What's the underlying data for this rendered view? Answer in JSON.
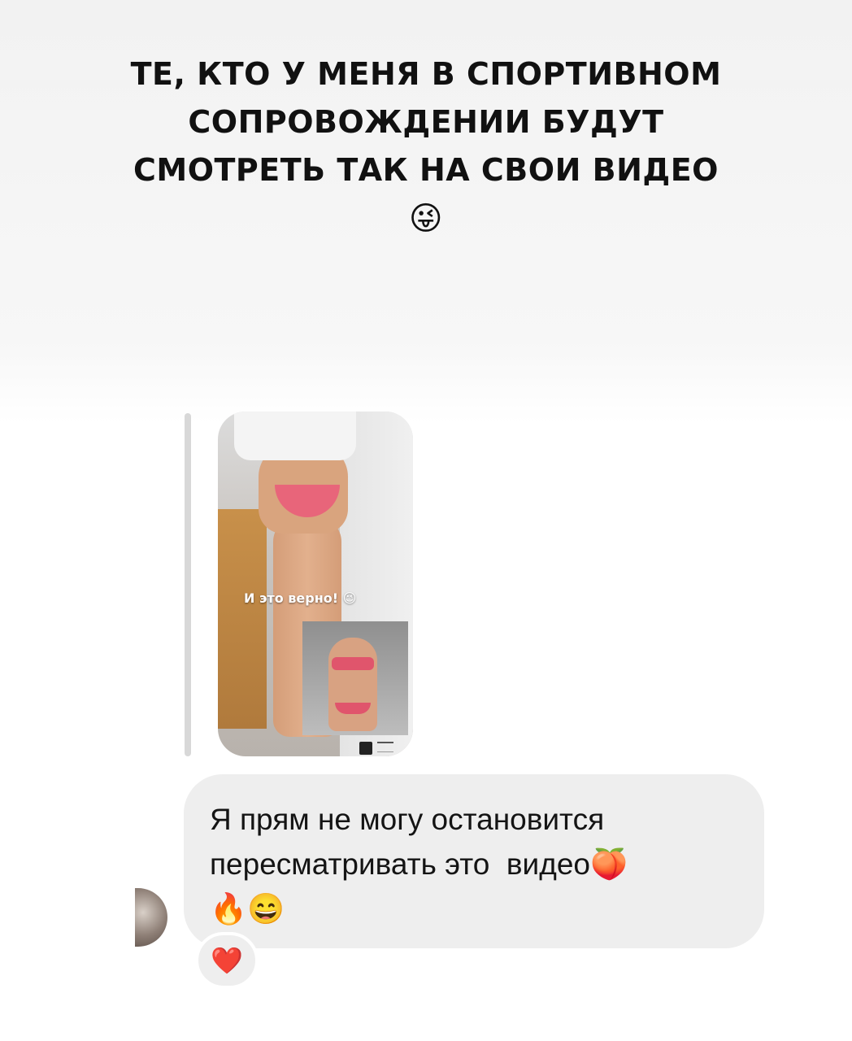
{
  "story": {
    "headline_lines": [
      "ТЕ, КТО У МЕНЯ В СПОРТИВНОМ",
      "СОПРОВОЖДЕНИИ БУДУТ",
      "СМОТРЕТЬ ТАК  НА СВОИ ВИДЕО"
    ],
    "headline_emoji": "😜"
  },
  "reply_preview": {
    "overlay_text": "И это верно! 😉"
  },
  "message": {
    "text": "Я прям не могу остановится\nпересматривать это  видео🍑\n🔥😄"
  },
  "reaction": {
    "emoji": "❤️"
  },
  "colors": {
    "bubble": "#eeeeee",
    "text": "#141414",
    "reaction": "#e0243a"
  },
  "icons": {
    "avatar": "sender-avatar",
    "reaction": "heart-icon"
  }
}
